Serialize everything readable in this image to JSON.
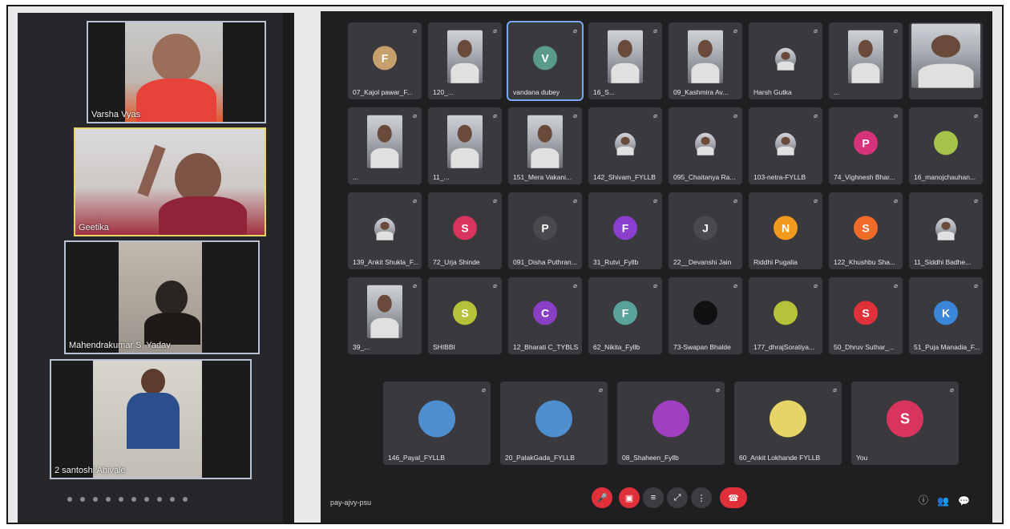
{
  "speakers": [
    {
      "name": "Varsha Vyas"
    },
    {
      "name": "Geetika"
    },
    {
      "name": "Mahendrakumar  S. Yadav"
    },
    {
      "name": "2 santoshi Ahivale"
    }
  ],
  "grid": [
    {
      "label": "07_Kajol pawar_F...",
      "avatar": "F",
      "color": "#c7a16d",
      "kind": "letter"
    },
    {
      "label": "120_...",
      "kind": "photo"
    },
    {
      "label": "vandana dubey",
      "avatar": "V",
      "color": "#5a9a8a",
      "kind": "letter",
      "selected": true
    },
    {
      "label": "16_S...",
      "kind": "photo"
    },
    {
      "label": "09_Kashmira Av...",
      "kind": "photo"
    },
    {
      "label": "Harsh Gutka",
      "kind": "photo-small"
    },
    {
      "label": "...",
      "kind": "photo"
    },
    {
      "label": "",
      "kind": "photo-wide"
    },
    {
      "label": "...",
      "kind": "photo"
    },
    {
      "label": "11_...",
      "kind": "photo"
    },
    {
      "label": "151_Mera Vakani...",
      "kind": "photo"
    },
    {
      "label": "142_Shivam_FYLLB",
      "kind": "photo-small"
    },
    {
      "label": "095_Chaitanya Ra...",
      "kind": "photo-small"
    },
    {
      "label": "103-netra-FYLLB",
      "kind": "photo-small"
    },
    {
      "label": "74_Vighnesh Bhar...",
      "avatar": "P",
      "color": "#d6337a",
      "kind": "letter"
    },
    {
      "label": "16_manojchauhan...",
      "avatar": "",
      "color": "#a6c34a",
      "kind": "letter"
    },
    {
      "label": "139_Ankit Shukla_F...",
      "kind": "photo-small"
    },
    {
      "label": "72_Urja Shinde",
      "avatar": "S",
      "color": "#d9345d",
      "kind": "letter"
    },
    {
      "label": "091_Disha Puthran...",
      "avatar": "P",
      "color": "#4a4a4e",
      "kind": "letter"
    },
    {
      "label": "31_Rutvi_Fyllb",
      "avatar": "F",
      "color": "#8b3fcf",
      "kind": "letter"
    },
    {
      "label": "22__Devanshi Jain",
      "avatar": "J",
      "color": "#4a4a4e",
      "kind": "letter"
    },
    {
      "label": "Riddhi Pugalia",
      "avatar": "N",
      "color": "#f29a1e",
      "kind": "letter"
    },
    {
      "label": "122_Khushbu Sha...",
      "avatar": "S",
      "color": "#f06a2a",
      "kind": "letter"
    },
    {
      "label": "11_Siddhi Badhe...",
      "kind": "photo-small"
    },
    {
      "label": "39_...",
      "kind": "photo"
    },
    {
      "label": "SHIBBI",
      "avatar": "S",
      "color": "#b6c23a",
      "kind": "letter"
    },
    {
      "label": "12_Bharati C_TYBLS",
      "avatar": "C",
      "color": "#8a3fc4",
      "kind": "letter"
    },
    {
      "label": "62_Nikita_Fyllb",
      "avatar": "F",
      "color": "#5aa39a",
      "kind": "letter"
    },
    {
      "label": "73-Swapan Bhalde",
      "avatar": "",
      "color": "#101012",
      "kind": "letter"
    },
    {
      "label": "177_dhrajSoratiya...",
      "avatar": "",
      "color": "#b6c23a",
      "kind": "letter"
    },
    {
      "label": "50_Dhruv Suthar_...",
      "avatar": "S",
      "color": "#e0303a",
      "kind": "letter"
    },
    {
      "label": "51_Puja Manadia_F...",
      "avatar": "K",
      "color": "#3a86d8",
      "kind": "letter"
    }
  ],
  "bottom_row": [
    {
      "label": "146_Payal_FYLLB",
      "color": "#4e8fcf"
    },
    {
      "label": "20_PalakGada_FYLLB",
      "color": "#4e8fcf"
    },
    {
      "label": "08_Shaheen_Fyllb",
      "color": "#a13fc1"
    },
    {
      "label": "60_Ankit Lokhande FYLLB",
      "color": "#e6d467"
    },
    {
      "label": "You",
      "avatar": "S",
      "color": "#d9345d"
    }
  ],
  "meeting_code": "pay-ajvy-psu"
}
